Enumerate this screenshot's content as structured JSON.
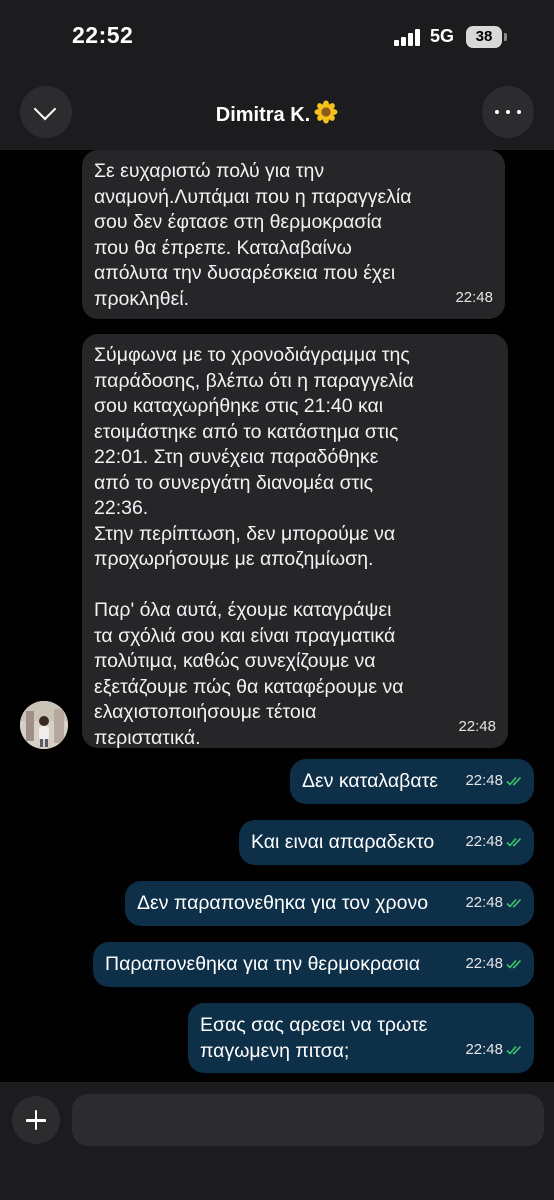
{
  "status_bar": {
    "time": "22:52",
    "network": "5G",
    "battery": "38"
  },
  "header": {
    "contact_name": "Dimitra K.",
    "contact_emoji_icon": "sunflower-icon",
    "back_icon": "chevron-down-icon",
    "more_icon": "more-horizontal-icon"
  },
  "messages": {
    "incoming": [
      {
        "text": "Σε ευχαριστώ πολύ για την\nαναμονή.Λυπάμαι που η παραγγελία\nσου δεν έφτασε στη θερμοκρασία\nπου θα έπρεπε. Καταλαβαίνω\nαπόλυτα την δυσαρέσκεια που έχει\nπροκληθεί.",
        "time": "22:48"
      },
      {
        "text": "Σύμφωνα με το χρονοδιάγραμμα της\nπαράδοσης, βλέπω ότι η παραγγελία\nσου καταχωρήθηκε στις 21:40 και\nετοιμάστηκε από το κατάστημα στις\n22:01. Στη συνέχεια παραδόθηκε\nαπό το συνεργάτη διανομέα στις\n22:36.\nΣτην περίπτωση, δεν μπορούμε να\nπροχωρήσουμε με αποζημίωση.\n\nΠαρ' όλα αυτά, έχουμε καταγράψει\nτα σχόλιά σου και είναι πραγματικά\nπολύτιμα, καθώς συνεχίζουμε να\nεξετάζουμε πώς θα καταφέρουμε να\nελαχιστοποιήσουμε τέτοια\nπεριστατικά.",
        "time": "22:48"
      }
    ],
    "outgoing": [
      {
        "text": "Δεν καταλαβατε",
        "time": "22:48"
      },
      {
        "text": "Και ειναι απαραδεκτο",
        "time": "22:48"
      },
      {
        "text": "Δεν παραπονεθηκα για τον χρονο",
        "time": "22:48"
      },
      {
        "text": "Παραπονεθηκα για την θερμοκρασια",
        "time": "22:48"
      },
      {
        "text": "Εσας σας αρεσει να τρωτε\nπαγωμενη πιτσα;",
        "time": "22:48"
      }
    ]
  },
  "composer": {
    "attach_icon": "plus-icon",
    "input_value": ""
  },
  "colors": {
    "app_background": "#000000",
    "bar_background": "#1c1c1e",
    "incoming_bubble": "#262628",
    "outgoing_bubble": "#0d2f48",
    "read_tick": "#3ec46d"
  }
}
